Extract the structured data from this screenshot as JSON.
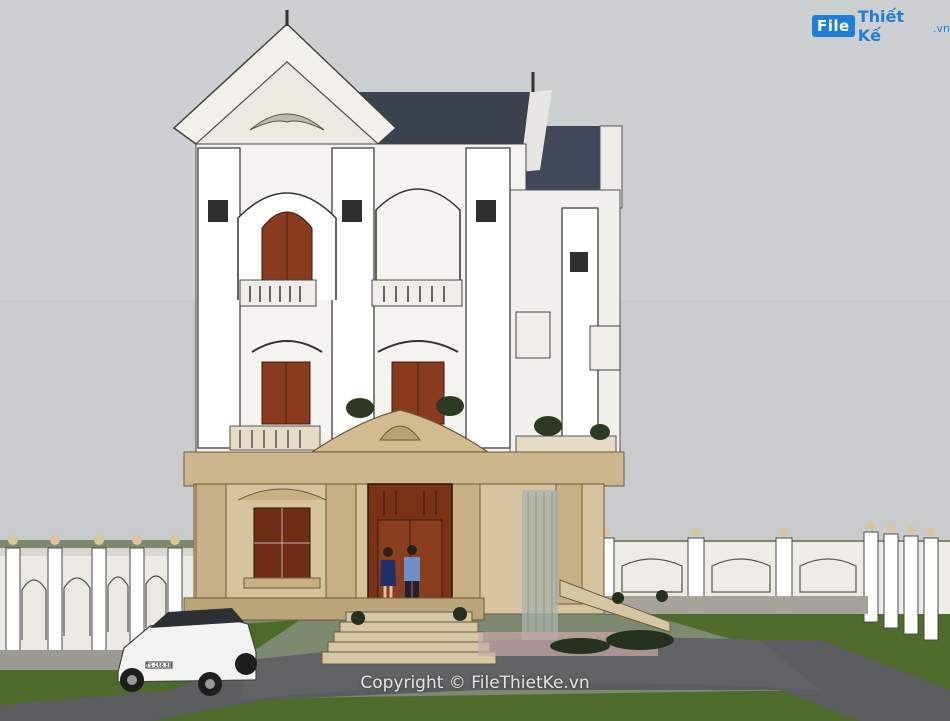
{
  "logo": {
    "file": "File",
    "name": "Thiết Kế",
    "domain": ".vn"
  },
  "watermark": {
    "text": "Copyright © FileThietKe.vn"
  },
  "car_plate": "TS-168.88",
  "colors": {
    "sky": "#c9cbcc",
    "roof": "#3c4250",
    "facade_white": "#f4f3ef",
    "stone": "#cdb68e",
    "wood_door": "#8a3b1e",
    "lawn": "#4f6b2c",
    "road": "#5b5d5e",
    "logo_blue": "#1f7fd6"
  }
}
